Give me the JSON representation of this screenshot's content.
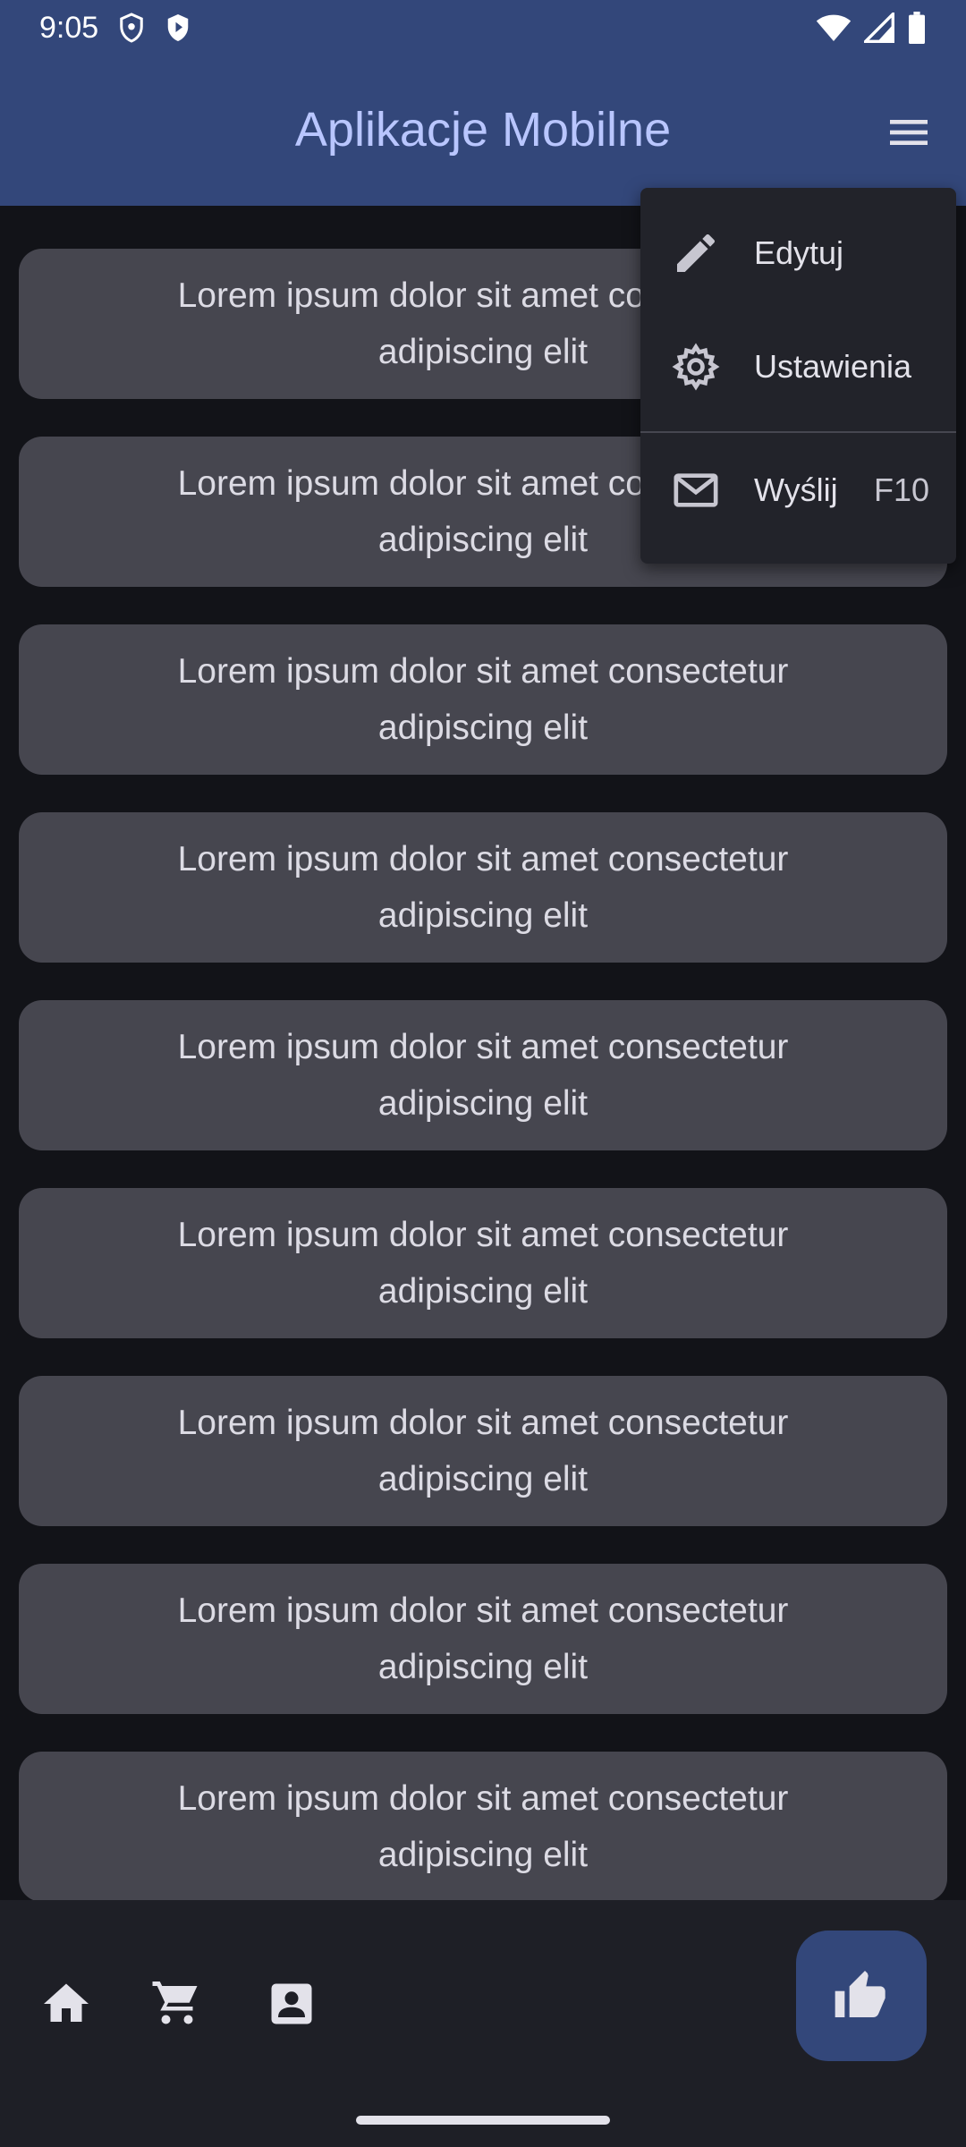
{
  "status_bar": {
    "time": "9:05",
    "left_icons": [
      "shield-outline-icon",
      "shield-play-icon"
    ],
    "right_icons": [
      "wifi-icon",
      "signal-icon",
      "battery-icon"
    ]
  },
  "app_bar": {
    "title": "Aplikacje Mobilne",
    "menu_icon": "hamburger-menu-icon"
  },
  "cards": [
    "Lorem ipsum dolor sit amet consectetur adipiscing elit",
    "Lorem ipsum dolor sit amet consectetur adipiscing elit",
    "Lorem ipsum dolor sit amet consectetur adipiscing elit",
    "Lorem ipsum dolor sit amet consectetur adipiscing elit",
    "Lorem ipsum dolor sit amet consectetur adipiscing elit",
    "Lorem ipsum dolor sit amet consectetur adipiscing elit",
    "Lorem ipsum dolor sit amet consectetur adipiscing elit",
    "Lorem ipsum dolor sit amet consectetur adipiscing elit",
    "Lorem ipsum dolor sit amet consectetur adipiscing elit"
  ],
  "popup_menu": {
    "items": [
      {
        "label": "Edytuj",
        "icon": "pencil-icon",
        "shortcut": ""
      },
      {
        "label": "Ustawienia",
        "icon": "gear-icon",
        "shortcut": ""
      },
      {
        "label": "Wyślij",
        "icon": "envelope-icon",
        "shortcut": "F10"
      }
    ]
  },
  "bottom_bar": {
    "icons": [
      "home-icon",
      "cart-icon",
      "contact-icon"
    ],
    "fab_icon": "thumb-up-icon"
  },
  "colors": {
    "app_bar": "#33477a",
    "title": "#b9c6ff",
    "background": "#121318",
    "card": "#46464f",
    "popup": "#22232a",
    "bottom_bar": "#1e1f26"
  }
}
